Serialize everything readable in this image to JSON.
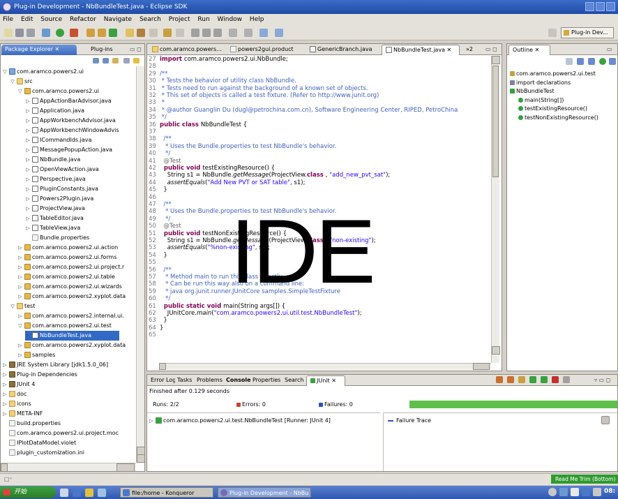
{
  "window": {
    "title": "Plug-in Development - NbBundleTest.java - Eclipse SDK"
  },
  "menu": [
    "File",
    "Edit",
    "Source",
    "Refactor",
    "Navigate",
    "Search",
    "Project",
    "Run",
    "Window",
    "Help"
  ],
  "perspective": {
    "label": "Plug-in Dev..."
  },
  "left": {
    "tabs": [
      "Package Explorer",
      "Plug-ins"
    ],
    "tree": [
      {
        "label": "com.aramco.powers2.ui",
        "icon": "proj",
        "indent": 0,
        "tw": "▽"
      },
      {
        "label": "src",
        "icon": "folder",
        "indent": 1,
        "tw": "▽"
      },
      {
        "label": "com.aramco.powers2.ui",
        "icon": "pkg",
        "indent": 2,
        "tw": "▽"
      },
      {
        "label": "AppActionBarAdvisor.java",
        "icon": "java",
        "indent": 3,
        "tw": "▷"
      },
      {
        "label": "Application.java",
        "icon": "java",
        "indent": 3,
        "tw": "▷"
      },
      {
        "label": "AppWorkbenchAdvisor.java",
        "icon": "java",
        "indent": 3,
        "tw": "▷"
      },
      {
        "label": "AppWorkbenchWindowAdvis",
        "icon": "java",
        "indent": 3,
        "tw": "▷"
      },
      {
        "label": "ICommandIds.java",
        "icon": "java",
        "indent": 3,
        "tw": "▷"
      },
      {
        "label": "MessagePopupAction.java",
        "icon": "java",
        "indent": 3,
        "tw": "▷"
      },
      {
        "label": "NbBundle.java",
        "icon": "java",
        "indent": 3,
        "tw": "▷"
      },
      {
        "label": "OpenViewAction.java",
        "icon": "java",
        "indent": 3,
        "tw": "▷"
      },
      {
        "label": "Perspective.java",
        "icon": "java",
        "indent": 3,
        "tw": "▷"
      },
      {
        "label": "PluginConstants.java",
        "icon": "java",
        "indent": 3,
        "tw": "▷"
      },
      {
        "label": "Powers2Plugin.java",
        "icon": "java",
        "indent": 3,
        "tw": "▷"
      },
      {
        "label": "ProjectView.java",
        "icon": "java",
        "indent": 3,
        "tw": "▷"
      },
      {
        "label": "TableEditor.java",
        "icon": "java",
        "indent": 3,
        "tw": "▷"
      },
      {
        "label": "TableView.java",
        "icon": "java",
        "indent": 3,
        "tw": "▷"
      },
      {
        "label": "Bundle.properties",
        "icon": "file",
        "indent": 3,
        "tw": ""
      },
      {
        "label": "com.aramco.powers2.ui.action",
        "icon": "pkg",
        "indent": 2,
        "tw": "▷"
      },
      {
        "label": "com.aramco.powers2.ui.forms",
        "icon": "pkg",
        "indent": 2,
        "tw": "▷"
      },
      {
        "label": "com.aramco.powers2.ui.project.r",
        "icon": "pkg",
        "indent": 2,
        "tw": "▷"
      },
      {
        "label": "com.aramco.powers2.ui.table",
        "icon": "pkg",
        "indent": 2,
        "tw": "▷"
      },
      {
        "label": "com.aramco.powers2.ui.wizards",
        "icon": "pkg",
        "indent": 2,
        "tw": "▷"
      },
      {
        "label": "com.aramco.powers2.xyplot.data",
        "icon": "pkg",
        "indent": 2,
        "tw": "▷"
      },
      {
        "label": "test",
        "icon": "folder",
        "indent": 1,
        "tw": "▽"
      },
      {
        "label": "com.aramco.powers2.internal.ui.",
        "icon": "pkg",
        "indent": 2,
        "tw": "▷"
      },
      {
        "label": "com.aramco.powers2.ui.test",
        "icon": "pkg",
        "indent": 2,
        "tw": "▽"
      },
      {
        "label": "NbBundleTest.java",
        "icon": "java",
        "indent": 3,
        "tw": "▷",
        "selected": true
      },
      {
        "label": "com.aramco.powers2.xyplot.data",
        "icon": "pkg",
        "indent": 2,
        "tw": "▷"
      },
      {
        "label": "samples",
        "icon": "pkg",
        "indent": 2,
        "tw": "▷"
      },
      {
        "label": "JRE System Library [jdk1.5.0_06]",
        "icon": "jar",
        "indent": 0,
        "tw": "▷"
      },
      {
        "label": "Plug-in Dependencies",
        "icon": "jar",
        "indent": 0,
        "tw": "▷"
      },
      {
        "label": "JUnit 4",
        "icon": "jar",
        "indent": 0,
        "tw": "▷"
      },
      {
        "label": "doc",
        "icon": "folder",
        "indent": 0,
        "tw": "▷"
      },
      {
        "label": "icons",
        "icon": "folder",
        "indent": 0,
        "tw": "▷"
      },
      {
        "label": "META-INF",
        "icon": "folder",
        "indent": 0,
        "tw": "▷"
      },
      {
        "label": "build.properties",
        "icon": "file",
        "indent": 0,
        "tw": ""
      },
      {
        "label": "com.aramco.powers2.ui.project.moc",
        "icon": "file",
        "indent": 0,
        "tw": ""
      },
      {
        "label": "IPlotDataModel.violet",
        "icon": "file",
        "indent": 0,
        "tw": ""
      },
      {
        "label": "plugin_customization.ini",
        "icon": "file",
        "indent": 0,
        "tw": ""
      }
    ]
  },
  "editor": {
    "tabs": [
      "com.aramco.powers...",
      "powers2gui.product",
      "GenericBranch.java",
      "NbBundleTest.java",
      "»2"
    ],
    "overlay": "IDE",
    "lines": [
      {
        "n": "27",
        "p": [
          [
            "kw",
            "import"
          ],
          [
            "",
            "com.aramco.powers2.ui.NbBundle;"
          ]
        ]
      },
      {
        "n": "28",
        "p": []
      },
      {
        "n": "29",
        "p": [
          [
            "cm",
            "/**"
          ]
        ]
      },
      {
        "n": "30",
        "p": [
          [
            "cm",
            " * Tests the behavior of utility class NbBundle."
          ]
        ]
      },
      {
        "n": "31",
        "p": [
          [
            "cm",
            " * Tests need to run against the background of a known set of objects."
          ]
        ]
      },
      {
        "n": "32",
        "p": [
          [
            "cm",
            " * This set of objects is called a test fixture. (Refer to http://www.junit.org)"
          ]
        ]
      },
      {
        "n": "33",
        "p": [
          [
            "cm",
            " *"
          ]
        ]
      },
      {
        "n": "34",
        "p": [
          [
            "cm",
            " * @author Guanglin Du (dugl@petrochina.com.cn), Software Engineering Center, RIPED, PetroChina"
          ]
        ]
      },
      {
        "n": "35",
        "p": [
          [
            "cm",
            " */"
          ]
        ]
      },
      {
        "n": "36",
        "p": [
          [
            "kw",
            "public class"
          ],
          [
            "",
            "NbBundleTest {"
          ]
        ]
      },
      {
        "n": "37",
        "p": []
      },
      {
        "n": "38",
        "p": [
          [
            "cm",
            "  /**"
          ]
        ]
      },
      {
        "n": "39",
        "p": [
          [
            "cm",
            "   * Uses the Bundle.properties to test NbBundle's behavior."
          ]
        ]
      },
      {
        "n": "40",
        "p": [
          [
            "cm",
            "   */"
          ]
        ]
      },
      {
        "n": "41",
        "p": [
          [
            "ann",
            "  @Test"
          ]
        ]
      },
      {
        "n": "42",
        "p": [
          [
            "kw",
            "  public void"
          ],
          [
            "",
            "testExistingResource() {"
          ]
        ]
      },
      {
        "n": "43",
        "p": [
          [
            "",
            "    String s1 = NbBundle."
          ],
          [
            "it",
            "getMessage"
          ],
          [
            "",
            "(ProjectView."
          ],
          [
            "kw",
            "class"
          ],
          [
            "",
            ", "
          ],
          [
            "str",
            "\"add_new_pvt_sat\""
          ],
          [
            "",
            ");"
          ]
        ]
      },
      {
        "n": "44",
        "p": [
          [
            "it",
            "    assertEquals"
          ],
          [
            "",
            "("
          ],
          [
            "str",
            "\"Add New PVT or SAT table\""
          ],
          [
            "",
            ", s1);"
          ]
        ]
      },
      {
        "n": "45",
        "p": [
          [
            "",
            "  }"
          ]
        ]
      },
      {
        "n": "46",
        "p": []
      },
      {
        "n": "47",
        "p": [
          [
            "cm",
            "  /**"
          ]
        ]
      },
      {
        "n": "48",
        "p": [
          [
            "cm",
            "   * Uses the Bundle.properties to test NbBundle's behavior."
          ]
        ]
      },
      {
        "n": "49",
        "p": [
          [
            "cm",
            "   */"
          ]
        ]
      },
      {
        "n": "50",
        "p": [
          [
            "ann",
            "  @Test"
          ]
        ]
      },
      {
        "n": "51",
        "p": [
          [
            "kw",
            "  public void"
          ],
          [
            "",
            "testNonExistingResource() {"
          ]
        ]
      },
      {
        "n": "52",
        "p": [
          [
            "",
            "    String s1 = NbBundle."
          ],
          [
            "it",
            "getMessage"
          ],
          [
            "",
            "(ProjectView."
          ],
          [
            "kw",
            "class"
          ],
          [
            "",
            ", "
          ],
          [
            "str",
            "\"non-existing\""
          ],
          [
            "",
            ");"
          ]
        ]
      },
      {
        "n": "53",
        "p": [
          [
            "it",
            "    assertEquals"
          ],
          [
            "",
            "("
          ],
          [
            "str",
            "\"%non-existing\""
          ],
          [
            "",
            ", s1);"
          ]
        ]
      },
      {
        "n": "54",
        "p": [
          [
            "",
            "  }"
          ]
        ]
      },
      {
        "n": "55",
        "p": []
      },
      {
        "n": "56",
        "p": [
          [
            "cm",
            "  /**"
          ]
        ]
      },
      {
        "n": "57",
        "p": [
          [
            "cm",
            "   * Method main to run this class directly."
          ]
        ]
      },
      {
        "n": "58",
        "p": [
          [
            "cm",
            "   * Can be run this way also on a command line:"
          ]
        ]
      },
      {
        "n": "59",
        "p": [
          [
            "cm",
            "   * java org.junit.runner.JUnitCore samples.SimpleTestFixture"
          ]
        ]
      },
      {
        "n": "60",
        "p": [
          [
            "cm",
            "   */"
          ]
        ]
      },
      {
        "n": "61",
        "p": [
          [
            "kw",
            "  public static void"
          ],
          [
            "",
            "main(String args[]) {"
          ]
        ]
      },
      {
        "n": "62",
        "p": [
          [
            "",
            "    JUnitCore."
          ],
          [
            "it",
            "main"
          ],
          [
            "",
            "("
          ],
          [
            "str",
            "\"com.aramco.powers2.ui.util.test.NbBundleTest\""
          ],
          [
            "",
            ");"
          ]
        ]
      },
      {
        "n": "63",
        "p": [
          [
            "",
            "  }"
          ]
        ]
      },
      {
        "n": "64",
        "p": [
          [
            "",
            "}"
          ]
        ]
      },
      {
        "n": "65",
        "p": []
      }
    ]
  },
  "outline": {
    "tab": "Outline",
    "items": [
      {
        "label": "com.aramco.powers2.ui.test",
        "indent": 0,
        "color": "#c8a040"
      },
      {
        "label": "import declarations",
        "indent": 0,
        "color": "#8080a0"
      },
      {
        "label": "NbBundleTest",
        "indent": 0,
        "color": "#30a040"
      },
      {
        "label": "main(String[])",
        "indent": 1,
        "color": "#30a040"
      },
      {
        "label": "testExistingResource()",
        "indent": 1,
        "color": "#30a040"
      },
      {
        "label": "testNonExistingResource()",
        "indent": 1,
        "color": "#30a040"
      }
    ]
  },
  "bottom": {
    "tabs": [
      "Error Log",
      "Tasks",
      "Problems",
      "Console",
      "Properties",
      "Search",
      "JUnit"
    ],
    "finished": "Finished after 0.129 seconds",
    "runs_label": "Runs:",
    "runs_value": "2/2",
    "errors_label": "Errors:",
    "errors_value": "0",
    "failures_label": "Failures:",
    "failures_value": "0",
    "test_item": "com.aramco.powers2.ui.test.NbBundleTest [Runner: JUnit 4]",
    "failure_trace": "Failure Trace",
    "progress_color": "#5fbf4a"
  },
  "status": {
    "read_me": "Read Me Trim (Bottom)"
  },
  "taskbar": {
    "start": "开始",
    "tasks": [
      "file:/home - Konqueror",
      "Plug-in Development - NbBu"
    ],
    "clock": "08:"
  }
}
